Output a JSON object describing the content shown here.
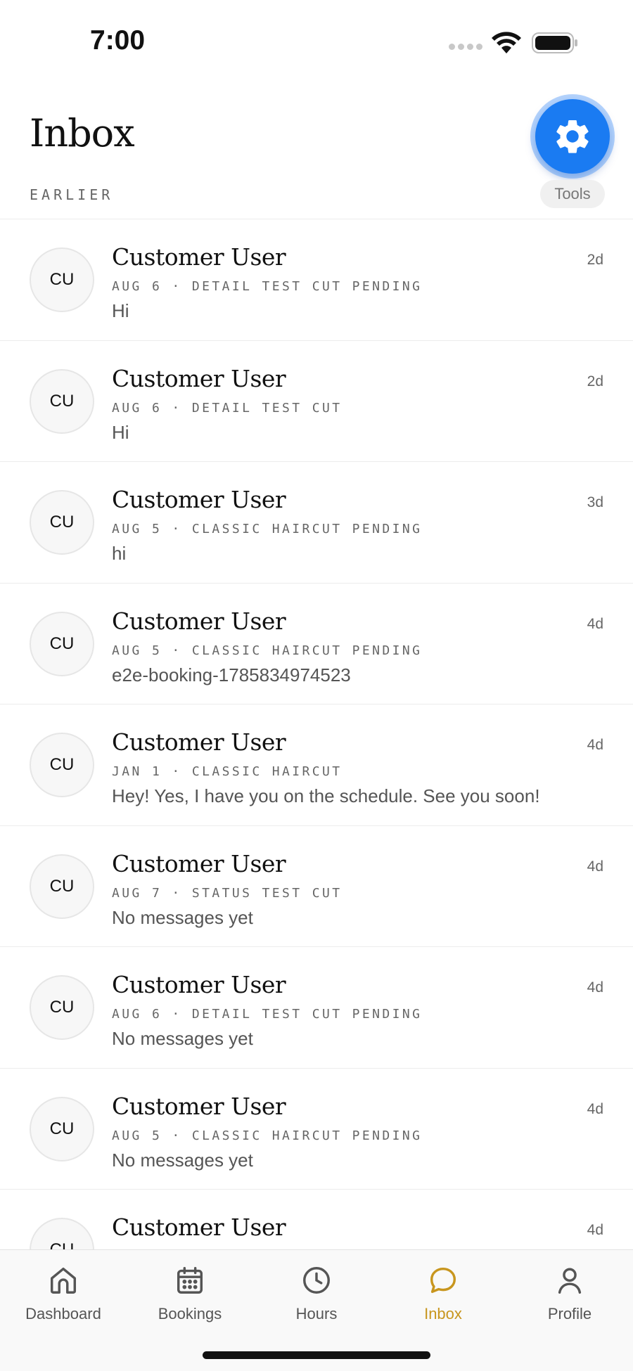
{
  "status_bar": {
    "time": "7:00"
  },
  "header": {
    "title": "Inbox",
    "section_label": "EARLIER",
    "tools_label": "Tools"
  },
  "threads": [
    {
      "initials": "CU",
      "name": "Customer User",
      "meta": "AUG 6 · DETAIL TEST CUT PENDING",
      "preview": "Hi",
      "time": "2d"
    },
    {
      "initials": "CU",
      "name": "Customer User",
      "meta": "AUG 6 · DETAIL TEST CUT",
      "preview": "Hi",
      "time": "2d"
    },
    {
      "initials": "CU",
      "name": "Customer User",
      "meta": "AUG 5 · CLASSIC HAIRCUT PENDING",
      "preview": "hi",
      "time": "3d"
    },
    {
      "initials": "CU",
      "name": "Customer User",
      "meta": "AUG 5 · CLASSIC HAIRCUT PENDING",
      "preview": "e2e-booking-1785834974523",
      "time": "4d"
    },
    {
      "initials": "CU",
      "name": "Customer User",
      "meta": "JAN 1 · CLASSIC HAIRCUT",
      "preview": "Hey! Yes, I have you on the schedule. See you soon!",
      "time": "4d"
    },
    {
      "initials": "CU",
      "name": "Customer User",
      "meta": "AUG 7 · STATUS TEST CUT",
      "preview": "No messages yet",
      "time": "4d"
    },
    {
      "initials": "CU",
      "name": "Customer User",
      "meta": "AUG 6 · DETAIL TEST CUT PENDING",
      "preview": "No messages yet",
      "time": "4d"
    },
    {
      "initials": "CU",
      "name": "Customer User",
      "meta": "AUG 5 · CLASSIC HAIRCUT PENDING",
      "preview": "No messages yet",
      "time": "4d"
    },
    {
      "initials": "CU",
      "name": "Customer User",
      "meta": "",
      "preview": "",
      "time": "4d"
    }
  ],
  "tab_bar": {
    "tabs": [
      {
        "label": "Dashboard",
        "icon": "home-icon"
      },
      {
        "label": "Bookings",
        "icon": "calendar-icon"
      },
      {
        "label": "Hours",
        "icon": "clock-icon"
      },
      {
        "label": "Inbox",
        "icon": "chat-bubble-icon",
        "active": true
      },
      {
        "label": "Profile",
        "icon": "person-icon"
      }
    ]
  },
  "colors": {
    "accent_active": "#c8961e",
    "fab_blue": "#1a7bf2",
    "tab_inactive": "#555555"
  }
}
